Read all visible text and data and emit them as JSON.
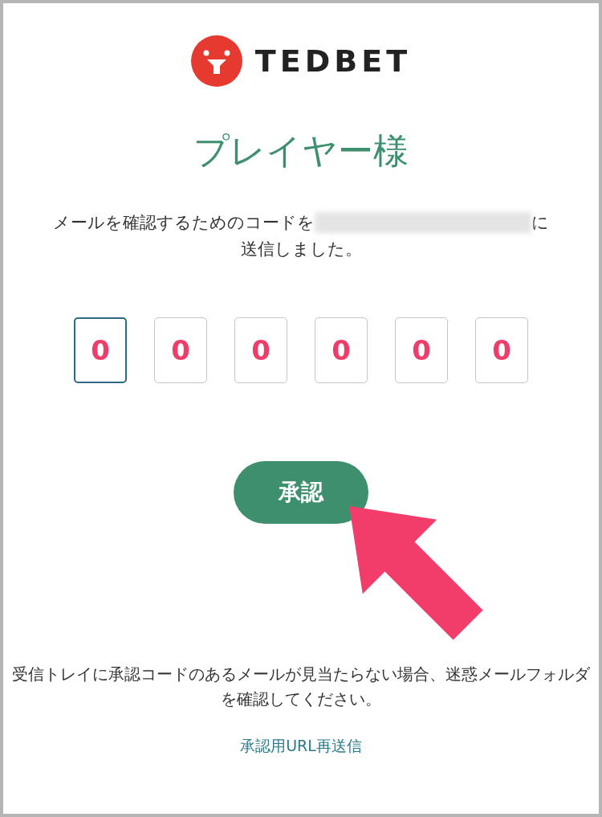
{
  "logo": {
    "text": "TEDBET"
  },
  "title": "プレイヤー様",
  "message": {
    "before": "メールを確認するためのコードを",
    "after": "に",
    "second_line": "送信しました。"
  },
  "code_fields": [
    {
      "value": "0",
      "focused": true
    },
    {
      "value": "0",
      "focused": false
    },
    {
      "value": "0",
      "focused": false
    },
    {
      "value": "0",
      "focused": false
    },
    {
      "value": "0",
      "focused": false
    },
    {
      "value": "0",
      "focused": false
    }
  ],
  "button": {
    "label": "承認"
  },
  "notice": "受信トレイに承認コードのあるメールが見当たらない場合、迷惑メールフォルダを確認してください。",
  "resend_link": "承認用URL再送信"
}
